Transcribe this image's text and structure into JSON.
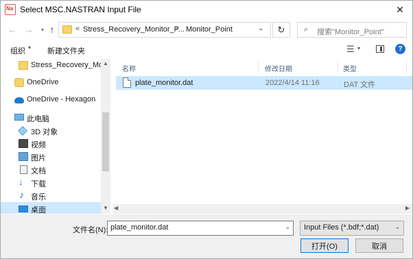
{
  "window": {
    "title": "Select MSC.NASTRAN Input File",
    "app_icon_text": "Na",
    "close_glyph": "✕"
  },
  "address": {
    "overflow": "«",
    "crumb1": "Stress_Recovery_Monitor_P...",
    "sep": "›",
    "crumb2": "Monitor_Point",
    "dropdown": "⌄",
    "refresh": "↻"
  },
  "search": {
    "placeholder": "搜索\"Monitor_Point\"",
    "icon": "⌕"
  },
  "toolbar": {
    "organize": "组织",
    "new_folder": "新建文件夹",
    "help": "?"
  },
  "nav": {
    "items": [
      {
        "label": "Stress_Recovery_Moni",
        "icon": "folder-icon"
      },
      {
        "label": "OneDrive",
        "icon": "onedrive-personal-icon"
      },
      {
        "label": "OneDrive - Hexagon",
        "icon": "onedrive-business-icon"
      },
      {
        "label": "此电脑",
        "icon": "computer-icon"
      },
      {
        "label": "3D 对象",
        "icon": "3d-objects-icon"
      },
      {
        "label": "视频",
        "icon": "video-icon"
      },
      {
        "label": "图片",
        "icon": "pictures-icon"
      },
      {
        "label": "文档",
        "icon": "documents-icon"
      },
      {
        "label": "下载",
        "icon": "downloads-icon"
      },
      {
        "label": "音乐",
        "icon": "music-icon"
      },
      {
        "label": "桌面",
        "icon": "desktop-icon"
      }
    ],
    "selected_index": 10
  },
  "files": {
    "columns": [
      "名称",
      "修改日期",
      "类型"
    ],
    "rows": [
      {
        "name": "plate_monitor.dat",
        "modified": "2022/4/14 11:16",
        "type": "DAT 文件"
      }
    ]
  },
  "footer": {
    "filename_label": "文件名(N):",
    "filename_value": "plate_monitor.dat",
    "filetype_value": "Input Files (*.bdf;*.dat)",
    "open_label": "打开(O)",
    "cancel_label": "取消"
  },
  "colors": {
    "selection": "#cce8ff",
    "accent": "#0078d7"
  }
}
